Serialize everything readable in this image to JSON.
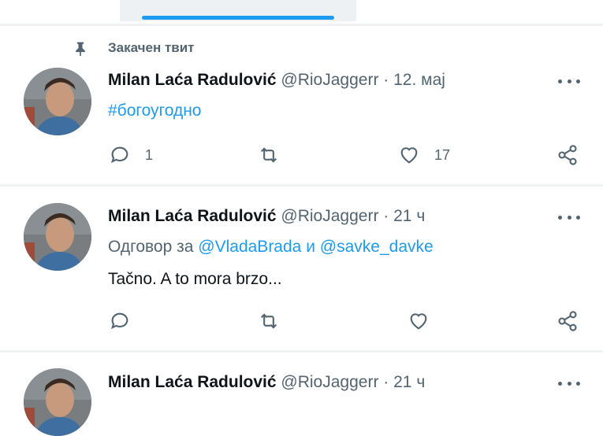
{
  "pinned_label": "Закачен твит",
  "tweets": [
    {
      "name": "Milan Laća Radulović",
      "handle": "@RioJaggerr",
      "sep": "·",
      "time": "12. мај",
      "reply_prefix": "",
      "mention1": "",
      "reply_and": "",
      "mention2": "",
      "body": "",
      "hashtag": "#богоугодно",
      "reply_count": "1",
      "retweet_count": "",
      "like_count": "17"
    },
    {
      "name": "Milan Laća Radulović",
      "handle": "@RioJaggerr",
      "sep": "·",
      "time": "21 ч",
      "reply_prefix": "Одговор за",
      "mention1": "@VladaBrada",
      "reply_and": "и",
      "mention2": "@savke_davke",
      "body": "Tačno. A to mora brzo...",
      "hashtag": "",
      "reply_count": "",
      "retweet_count": "",
      "like_count": ""
    },
    {
      "name": "Milan Laća Radulović",
      "handle": "@RioJaggerr",
      "sep": "·",
      "time": "21 ч"
    }
  ],
  "icons": {
    "pin": "pin-icon",
    "more": "more-icon",
    "reply": "reply-icon",
    "retweet": "retweet-icon",
    "like": "like-icon",
    "share": "share-icon"
  },
  "colors": {
    "accent": "#1d9bf0",
    "secondary_text": "#536471",
    "primary_text": "#0f1419"
  }
}
